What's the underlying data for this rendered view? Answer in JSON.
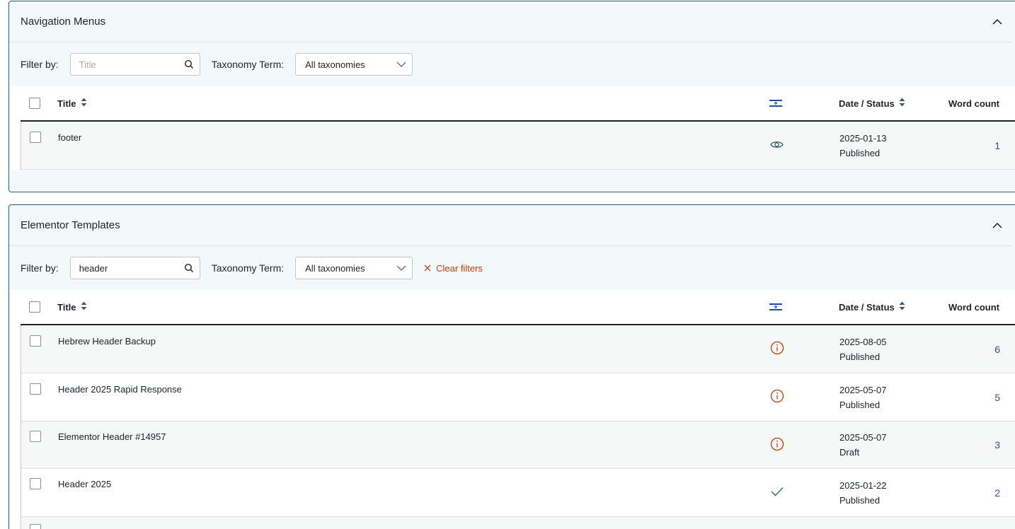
{
  "panels": [
    {
      "title": "Navigation Menus",
      "filter_label": "Filter by:",
      "search_value": "",
      "search_placeholder": "Title",
      "taxonomy_label": "Taxonomy Term:",
      "taxonomy_value": "All taxonomies",
      "columns": {
        "title": "Title",
        "date_status": "Date / Status",
        "word_count": "Word count"
      },
      "rows": [
        {
          "title": "footer",
          "status_icon": "eye-icon",
          "date": "2025-01-13",
          "status": "Published",
          "word_count": "1"
        }
      ]
    },
    {
      "title": "Elementor Templates",
      "filter_label": "Filter by:",
      "search_value": "header",
      "search_placeholder": "Title",
      "taxonomy_label": "Taxonomy Term:",
      "taxonomy_value": "All taxonomies",
      "clear_filters": "Clear filters",
      "columns": {
        "title": "Title",
        "date_status": "Date / Status",
        "word_count": "Word count"
      },
      "rows": [
        {
          "title": "Hebrew Header Backup",
          "status_icon": "info-circle-icon",
          "date": "2025-08-05",
          "status": "Published",
          "word_count": "6"
        },
        {
          "title": "Header 2025 Rapid Response",
          "status_icon": "info-circle-icon",
          "date": "2025-05-07",
          "status": "Published",
          "word_count": "5"
        },
        {
          "title": "Elementor Header #14957",
          "status_icon": "info-circle-icon",
          "date": "2025-05-07",
          "status": "Draft",
          "word_count": "3"
        },
        {
          "title": "Header 2025",
          "status_icon": "check-icon",
          "date": "2025-01-22",
          "status": "Published",
          "word_count": "2"
        }
      ]
    }
  ],
  "colors": {
    "panel_border": "#2c5f73",
    "panel_bg": "#f3f8fa",
    "link": "#2c5f73",
    "warning": "#c2410c",
    "success": "#2c7a5f",
    "flag_blue": "#1f4fa3"
  }
}
